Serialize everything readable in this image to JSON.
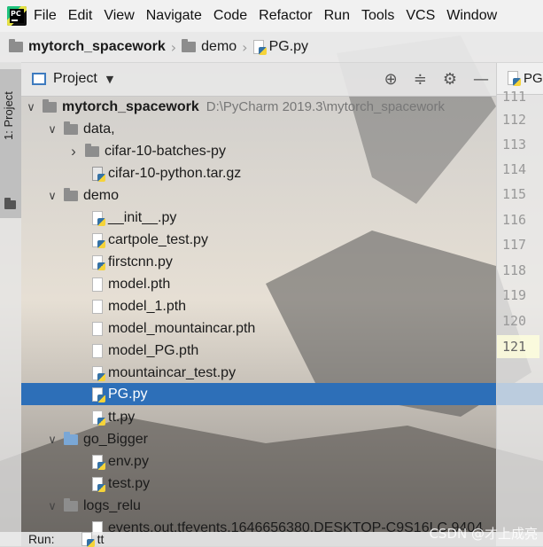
{
  "menu": {
    "items": [
      {
        "label": "File"
      },
      {
        "label": "Edit"
      },
      {
        "label": "View"
      },
      {
        "label": "Navigate"
      },
      {
        "label": "Code"
      },
      {
        "label": "Refactor"
      },
      {
        "label": "Run"
      },
      {
        "label": "Tools"
      },
      {
        "label": "VCS"
      },
      {
        "label": "Window"
      }
    ]
  },
  "breadcrumb": {
    "project": "mytorch_spacework",
    "folder": "demo",
    "file": "PG.py"
  },
  "toolstrip": {
    "project_tab": "1: Project"
  },
  "panel": {
    "title": "Project"
  },
  "tree": {
    "root_name": "mytorch_spacework",
    "root_path": "D:\\PyCharm 2019.3\\mytorch_spacework",
    "rows": [
      {
        "label": "data,"
      },
      {
        "label": "cifar-10-batches-py"
      },
      {
        "label": "cifar-10-python.tar.gz"
      },
      {
        "label": "demo"
      },
      {
        "label": "__init__.py"
      },
      {
        "label": "cartpole_test.py"
      },
      {
        "label": "firstcnn.py"
      },
      {
        "label": "model.pth"
      },
      {
        "label": "model_1.pth"
      },
      {
        "label": "model_mountaincar.pth"
      },
      {
        "label": "model_PG.pth"
      },
      {
        "label": "mountaincar_test.py"
      },
      {
        "label": "PG.py"
      },
      {
        "label": "tt.py"
      },
      {
        "label": "go_Bigger"
      },
      {
        "label": "env.py"
      },
      {
        "label": "test.py"
      },
      {
        "label": "logs_relu"
      },
      {
        "label": "events.out.tfevents.1646656380.DESKTOP-C9S16LC.9404"
      }
    ]
  },
  "editor": {
    "tab_label": "PG",
    "line_numbers": [
      "111",
      "112",
      "113",
      "114",
      "115",
      "116",
      "117",
      "118",
      "119",
      "120",
      "121"
    ],
    "current_line": "121"
  },
  "bottom": {
    "run_label": "Run:",
    "run_config": "tt"
  },
  "watermark": "CSDN @才上成亮"
}
